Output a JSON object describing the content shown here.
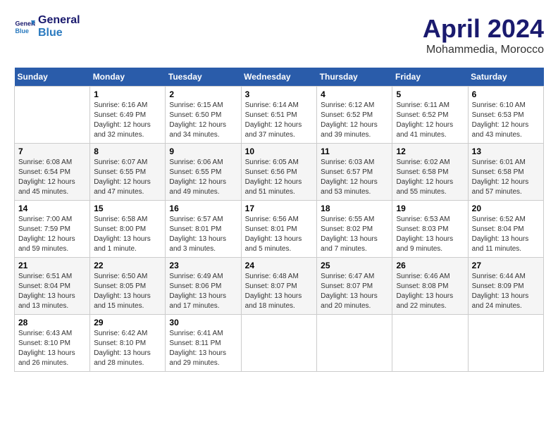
{
  "header": {
    "logo_line1": "General",
    "logo_line2": "Blue",
    "month": "April 2024",
    "location": "Mohammedia, Morocco"
  },
  "weekdays": [
    "Sunday",
    "Monday",
    "Tuesday",
    "Wednesday",
    "Thursday",
    "Friday",
    "Saturday"
  ],
  "weeks": [
    [
      {
        "day": "",
        "info": ""
      },
      {
        "day": "1",
        "info": "Sunrise: 6:16 AM\nSunset: 6:49 PM\nDaylight: 12 hours\nand 32 minutes."
      },
      {
        "day": "2",
        "info": "Sunrise: 6:15 AM\nSunset: 6:50 PM\nDaylight: 12 hours\nand 34 minutes."
      },
      {
        "day": "3",
        "info": "Sunrise: 6:14 AM\nSunset: 6:51 PM\nDaylight: 12 hours\nand 37 minutes."
      },
      {
        "day": "4",
        "info": "Sunrise: 6:12 AM\nSunset: 6:52 PM\nDaylight: 12 hours\nand 39 minutes."
      },
      {
        "day": "5",
        "info": "Sunrise: 6:11 AM\nSunset: 6:52 PM\nDaylight: 12 hours\nand 41 minutes."
      },
      {
        "day": "6",
        "info": "Sunrise: 6:10 AM\nSunset: 6:53 PM\nDaylight: 12 hours\nand 43 minutes."
      }
    ],
    [
      {
        "day": "7",
        "info": "Sunrise: 6:08 AM\nSunset: 6:54 PM\nDaylight: 12 hours\nand 45 minutes."
      },
      {
        "day": "8",
        "info": "Sunrise: 6:07 AM\nSunset: 6:55 PM\nDaylight: 12 hours\nand 47 minutes."
      },
      {
        "day": "9",
        "info": "Sunrise: 6:06 AM\nSunset: 6:55 PM\nDaylight: 12 hours\nand 49 minutes."
      },
      {
        "day": "10",
        "info": "Sunrise: 6:05 AM\nSunset: 6:56 PM\nDaylight: 12 hours\nand 51 minutes."
      },
      {
        "day": "11",
        "info": "Sunrise: 6:03 AM\nSunset: 6:57 PM\nDaylight: 12 hours\nand 53 minutes."
      },
      {
        "day": "12",
        "info": "Sunrise: 6:02 AM\nSunset: 6:58 PM\nDaylight: 12 hours\nand 55 minutes."
      },
      {
        "day": "13",
        "info": "Sunrise: 6:01 AM\nSunset: 6:58 PM\nDaylight: 12 hours\nand 57 minutes."
      }
    ],
    [
      {
        "day": "14",
        "info": "Sunrise: 7:00 AM\nSunset: 7:59 PM\nDaylight: 12 hours\nand 59 minutes."
      },
      {
        "day": "15",
        "info": "Sunrise: 6:58 AM\nSunset: 8:00 PM\nDaylight: 13 hours\nand 1 minute."
      },
      {
        "day": "16",
        "info": "Sunrise: 6:57 AM\nSunset: 8:01 PM\nDaylight: 13 hours\nand 3 minutes."
      },
      {
        "day": "17",
        "info": "Sunrise: 6:56 AM\nSunset: 8:01 PM\nDaylight: 13 hours\nand 5 minutes."
      },
      {
        "day": "18",
        "info": "Sunrise: 6:55 AM\nSunset: 8:02 PM\nDaylight: 13 hours\nand 7 minutes."
      },
      {
        "day": "19",
        "info": "Sunrise: 6:53 AM\nSunset: 8:03 PM\nDaylight: 13 hours\nand 9 minutes."
      },
      {
        "day": "20",
        "info": "Sunrise: 6:52 AM\nSunset: 8:04 PM\nDaylight: 13 hours\nand 11 minutes."
      }
    ],
    [
      {
        "day": "21",
        "info": "Sunrise: 6:51 AM\nSunset: 8:04 PM\nDaylight: 13 hours\nand 13 minutes."
      },
      {
        "day": "22",
        "info": "Sunrise: 6:50 AM\nSunset: 8:05 PM\nDaylight: 13 hours\nand 15 minutes."
      },
      {
        "day": "23",
        "info": "Sunrise: 6:49 AM\nSunset: 8:06 PM\nDaylight: 13 hours\nand 17 minutes."
      },
      {
        "day": "24",
        "info": "Sunrise: 6:48 AM\nSunset: 8:07 PM\nDaylight: 13 hours\nand 18 minutes."
      },
      {
        "day": "25",
        "info": "Sunrise: 6:47 AM\nSunset: 8:07 PM\nDaylight: 13 hours\nand 20 minutes."
      },
      {
        "day": "26",
        "info": "Sunrise: 6:46 AM\nSunset: 8:08 PM\nDaylight: 13 hours\nand 22 minutes."
      },
      {
        "day": "27",
        "info": "Sunrise: 6:44 AM\nSunset: 8:09 PM\nDaylight: 13 hours\nand 24 minutes."
      }
    ],
    [
      {
        "day": "28",
        "info": "Sunrise: 6:43 AM\nSunset: 8:10 PM\nDaylight: 13 hours\nand 26 minutes."
      },
      {
        "day": "29",
        "info": "Sunrise: 6:42 AM\nSunset: 8:10 PM\nDaylight: 13 hours\nand 28 minutes."
      },
      {
        "day": "30",
        "info": "Sunrise: 6:41 AM\nSunset: 8:11 PM\nDaylight: 13 hours\nand 29 minutes."
      },
      {
        "day": "",
        "info": ""
      },
      {
        "day": "",
        "info": ""
      },
      {
        "day": "",
        "info": ""
      },
      {
        "day": "",
        "info": ""
      }
    ]
  ]
}
